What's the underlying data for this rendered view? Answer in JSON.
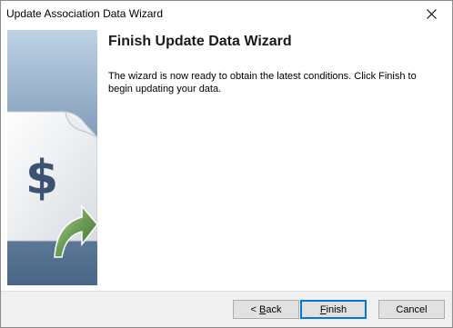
{
  "window": {
    "title": "Update Association Data Wizard"
  },
  "page": {
    "heading": "Finish Update Data Wizard",
    "description": "The wizard is now ready to obtain the latest conditions. Click Finish to begin updating your data."
  },
  "side_panel": {
    "glyph": "$",
    "icons": [
      "document-icon",
      "dollar-sign-icon",
      "green-arrow-icon"
    ]
  },
  "buttons": {
    "back_prefix": "< ",
    "back_accel": "B",
    "back_rest": "ack",
    "finish_accel": "F",
    "finish_rest": "inish",
    "cancel_label": "Cancel"
  },
  "colors": {
    "panel_top": "#b9cde0",
    "panel_bottom": "#4f6b89",
    "arrow_green": "#4c7f3c",
    "default_button_border": "#0078d7"
  }
}
